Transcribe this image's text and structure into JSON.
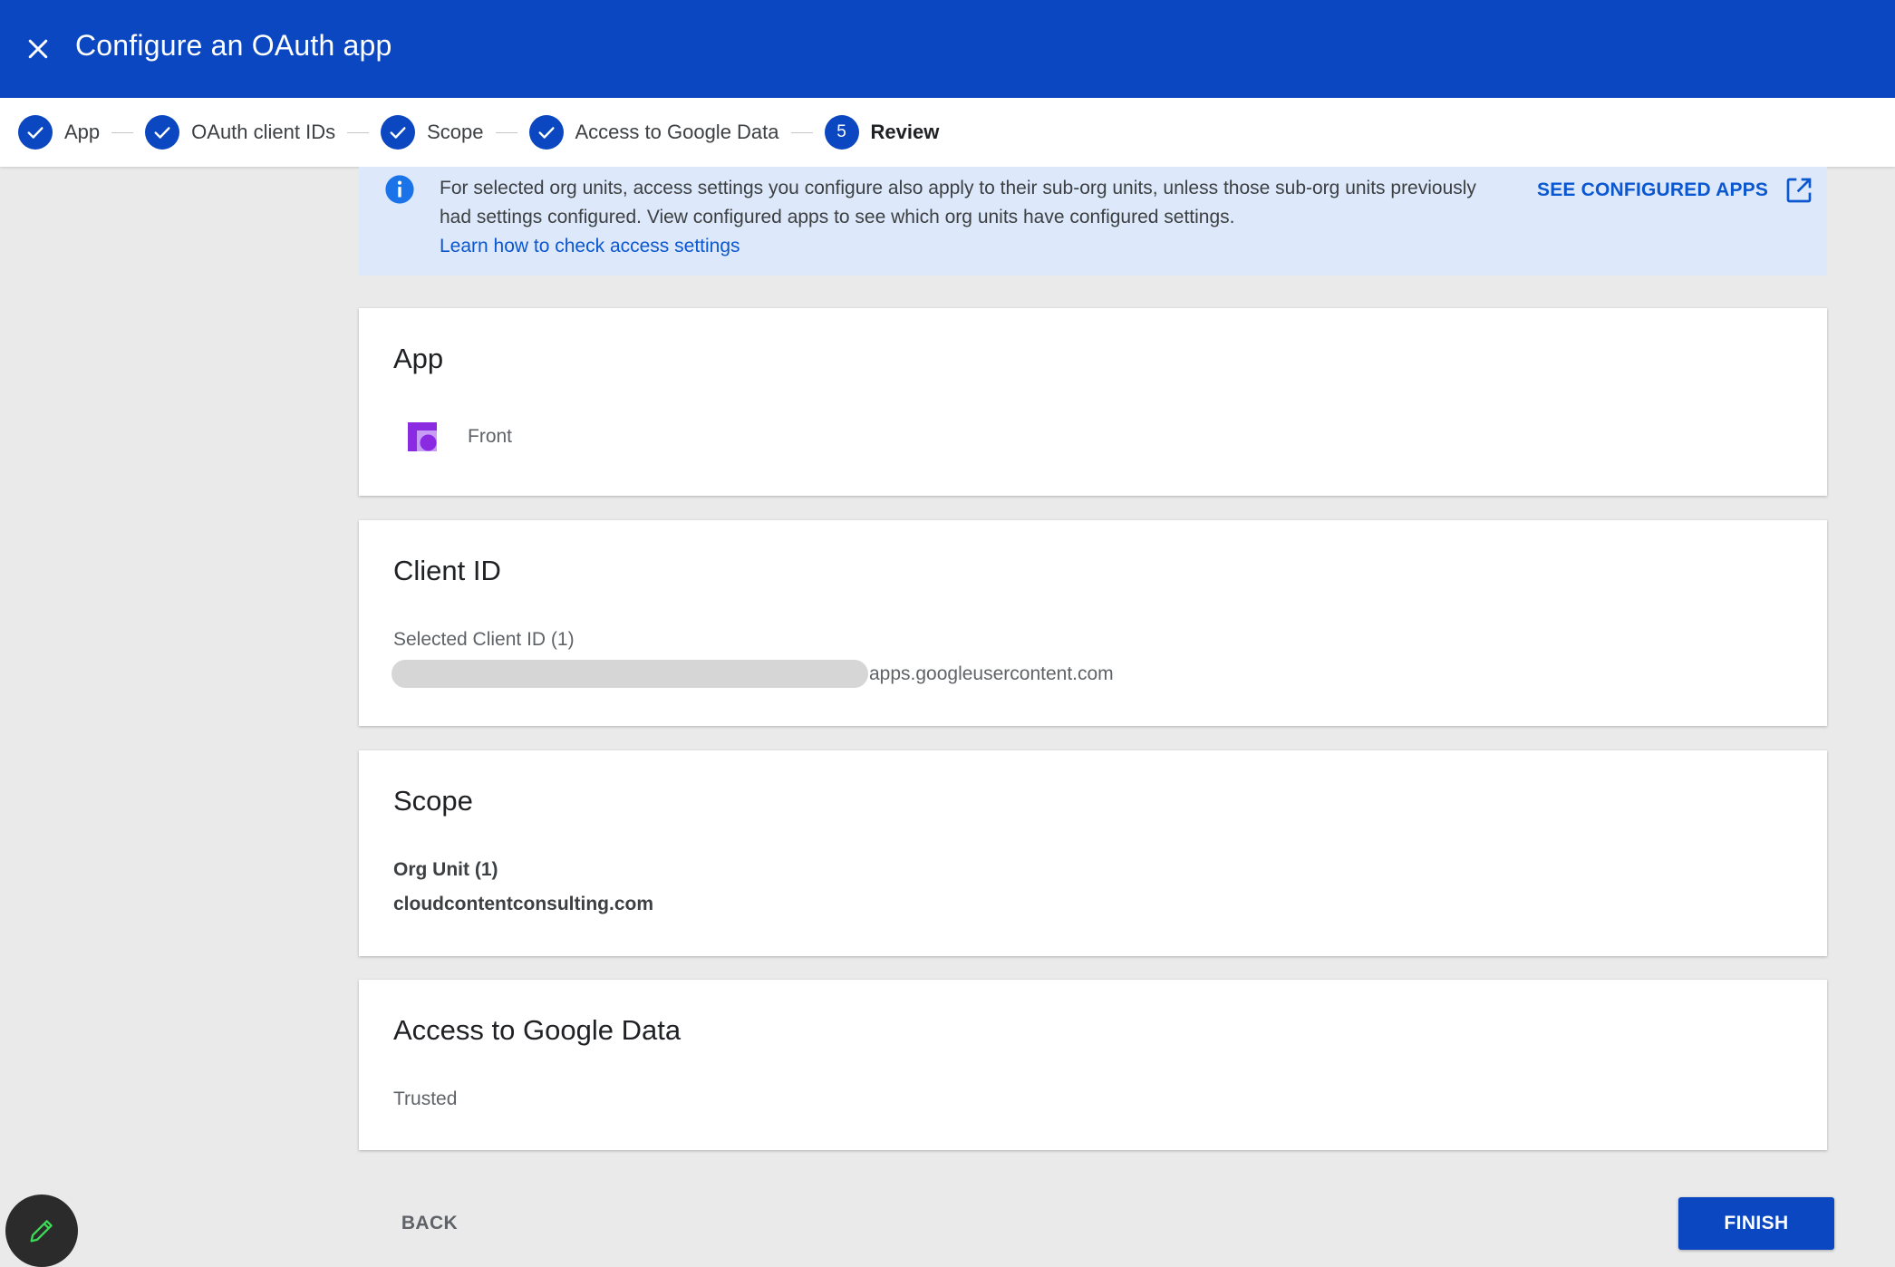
{
  "header": {
    "title": "Configure an OAuth app",
    "close_icon": "close-icon"
  },
  "stepper": {
    "steps": [
      {
        "label": "App",
        "status": "done"
      },
      {
        "label": "OAuth client IDs",
        "status": "done"
      },
      {
        "label": "Scope",
        "status": "done"
      },
      {
        "label": "Access to Google Data",
        "status": "done"
      },
      {
        "label": "Review",
        "status": "current",
        "number": "5"
      }
    ]
  },
  "info_banner": {
    "text": "For selected org units, access settings you configure also apply to their sub-org units, unless those sub-org units previously had settings configured. View configured apps to see which org units have configured settings.",
    "link": "Learn how to check access settings",
    "action_label": "SEE CONFIGURED APPS",
    "action_icon": "open-in-new-icon"
  },
  "cards": {
    "app": {
      "title": "App",
      "name": "Front",
      "icon": "front-app-logo"
    },
    "client_id": {
      "title": "Client ID",
      "label": "Selected Client ID (1)",
      "suffix": "apps.googleusercontent.com"
    },
    "scope": {
      "title": "Scope",
      "label": "Org Unit (1)",
      "value": "cloudcontentconsulting.com"
    },
    "access": {
      "title": "Access to Google Data",
      "value": "Trusted"
    }
  },
  "footer": {
    "back_label": "BACK",
    "finish_label": "FINISH",
    "fab_icon": "edit-pencil-icon"
  },
  "colors": {
    "brand": "#0b47c1",
    "link": "#0b57d0",
    "banner": "#dde8fa",
    "app_logo": "#8a2be2"
  }
}
